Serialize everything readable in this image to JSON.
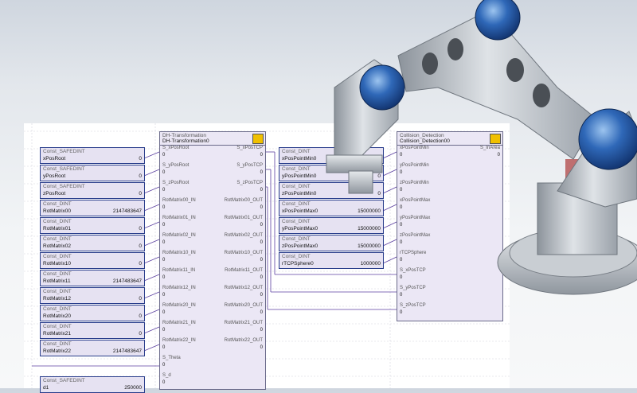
{
  "left_consts": [
    {
      "type": "Const_SAFEDINT",
      "name": "xPosRoot",
      "value": "0"
    },
    {
      "type": "Const_SAFEDINT",
      "name": "yPosRoot",
      "value": "0"
    },
    {
      "type": "Const_SAFEDINT",
      "name": "zPosRoot",
      "value": "0"
    },
    {
      "type": "Const_DINT",
      "name": "RotMatrix00",
      "value": "2147483647"
    },
    {
      "type": "Const_DINT",
      "name": "RotMatrix01",
      "value": "0"
    },
    {
      "type": "Const_DINT",
      "name": "RotMatrix02",
      "value": "0"
    },
    {
      "type": "Const_DINT",
      "name": "RotMatrix10",
      "value": "0"
    },
    {
      "type": "Const_DINT",
      "name": "RotMatrix11",
      "value": "2147483647"
    },
    {
      "type": "Const_DINT",
      "name": "RotMatrix12",
      "value": "0"
    },
    {
      "type": "Const_DINT",
      "name": "RotMatrix20",
      "value": "0"
    },
    {
      "type": "Const_DINT",
      "name": "RotMatrix21",
      "value": "0"
    },
    {
      "type": "Const_DINT",
      "name": "RotMatrix22",
      "value": "2147483647"
    },
    {
      "type": "Const_SAFEDINT",
      "name": "d1",
      "value": "250000"
    }
  ],
  "mid_consts": [
    {
      "type": "Const_DINT",
      "name": "xPosPointMin0",
      "value": "0"
    },
    {
      "type": "Const_DINT",
      "name": "yPosPointMin0",
      "value": "0"
    },
    {
      "type": "Const_DINT",
      "name": "zPosPointMin0",
      "value": "0"
    },
    {
      "type": "Const_DINT",
      "name": "xPosPointMax0",
      "value": "15000000"
    },
    {
      "type": "Const_DINT",
      "name": "yPosPointMax0",
      "value": "15000000"
    },
    {
      "type": "Const_DINT",
      "name": "zPosPointMax0",
      "value": "15000000"
    },
    {
      "type": "Const_DINT",
      "name": "rTCPSphere0",
      "value": "1000000"
    }
  ],
  "dh": {
    "type": "DH-Transformation",
    "instance": "DH-Transformation0",
    "inputs": [
      {
        "name": "S_xPosRoot",
        "value": "0"
      },
      {
        "name": "S_yPosRoot",
        "value": "0"
      },
      {
        "name": "S_zPosRoot",
        "value": "0"
      },
      {
        "name": "RotMatrix00_IN",
        "value": "0"
      },
      {
        "name": "RotMatrix01_IN",
        "value": "0"
      },
      {
        "name": "RotMatrix02_IN",
        "value": "0"
      },
      {
        "name": "RotMatrix10_IN",
        "value": "0"
      },
      {
        "name": "RotMatrix11_IN",
        "value": "0"
      },
      {
        "name": "RotMatrix12_IN",
        "value": "0"
      },
      {
        "name": "RotMatrix20_IN",
        "value": "0"
      },
      {
        "name": "RotMatrix21_IN",
        "value": "0"
      },
      {
        "name": "RotMatrix22_IN",
        "value": "0"
      },
      {
        "name": "S_Theta",
        "value": "0"
      },
      {
        "name": "S_d",
        "value": "0"
      }
    ],
    "outputs": [
      {
        "name": "S_xPosTCP",
        "value": "0"
      },
      {
        "name": "S_yPosTCP",
        "value": "0"
      },
      {
        "name": "S_zPosTCP",
        "value": "0"
      },
      {
        "name": "RotMatrix00_OUT",
        "value": "0"
      },
      {
        "name": "RotMatrix01_OUT",
        "value": "0"
      },
      {
        "name": "RotMatrix02_OUT",
        "value": "0"
      },
      {
        "name": "RotMatrix10_OUT",
        "value": "0"
      },
      {
        "name": "RotMatrix11_OUT",
        "value": "0"
      },
      {
        "name": "RotMatrix12_OUT",
        "value": "0"
      },
      {
        "name": "RotMatrix20_OUT",
        "value": "0"
      },
      {
        "name": "RotMatrix21_OUT",
        "value": "0"
      },
      {
        "name": "RotMatrix22_OUT",
        "value": "0"
      }
    ]
  },
  "cd": {
    "type": "Collision_Detection",
    "instance": "Collision_Detection00",
    "inputs": [
      {
        "name": "xPosPointMin",
        "value": "0"
      },
      {
        "name": "yPosPointMin",
        "value": "0"
      },
      {
        "name": "zPosPointMin",
        "value": "0"
      },
      {
        "name": "xPosPointMax",
        "value": "0"
      },
      {
        "name": "yPosPointMax",
        "value": "0"
      },
      {
        "name": "zPosPointMax",
        "value": "0"
      },
      {
        "name": "rTCPSphere",
        "value": "0"
      },
      {
        "name": "S_xPosTCP",
        "value": "0"
      },
      {
        "name": "S_yPosTCP",
        "value": "0"
      },
      {
        "name": "S_zPosTCP",
        "value": "0"
      }
    ],
    "outputs": [
      {
        "name": "S_InArea",
        "value": "0"
      }
    ]
  },
  "colors": {
    "wire": "#5b3fa0",
    "block_fill": "#ebe7f5",
    "const_border": "#2a3e8c",
    "robot_joint": "#2a5fb0",
    "robot_body": "#b9c0c8"
  },
  "icons": {
    "function_block": "robot-arm-icon",
    "collision": "warning-icon"
  }
}
